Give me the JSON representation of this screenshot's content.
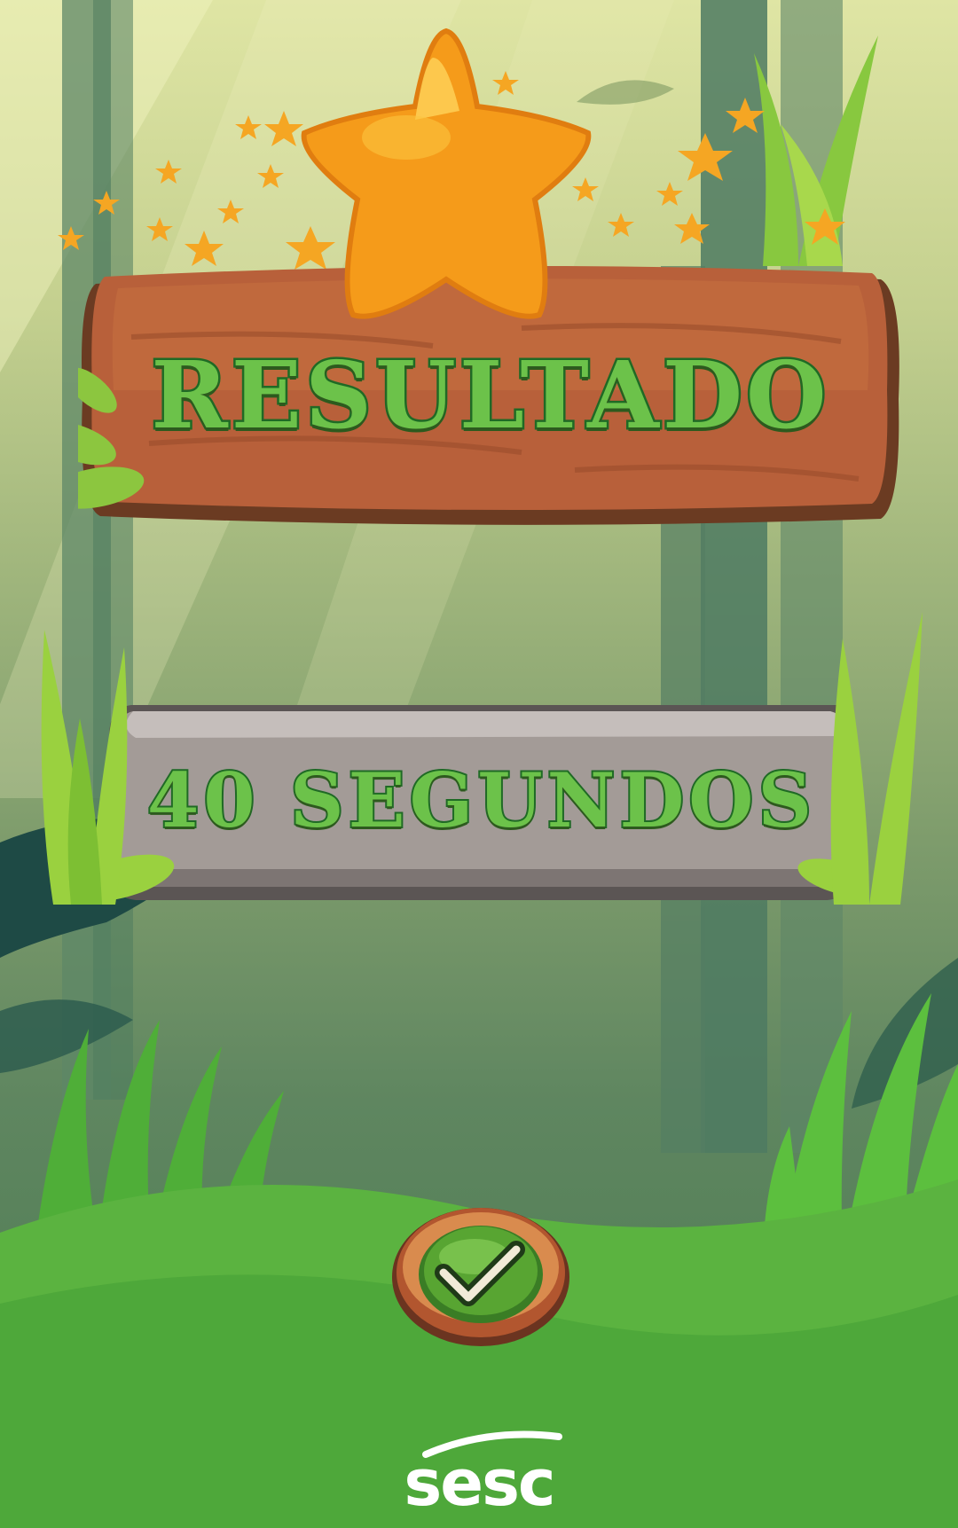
{
  "screen": {
    "title_label": "RESULTADO",
    "result_label": "40 SEGUNDOS"
  },
  "confirm_button": {
    "icon": "checkmark-icon"
  },
  "logo": {
    "text": "sesc"
  },
  "colors": {
    "title_fill": "#6cc24a",
    "title_outline": "#1f6a25",
    "wood": "#b8603a",
    "stone": "#a39b97",
    "star": "#f7a51b",
    "ground": "#5bb340"
  }
}
